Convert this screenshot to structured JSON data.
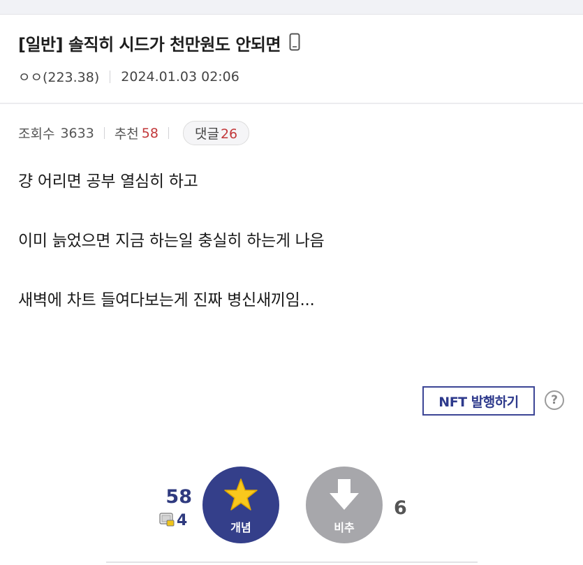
{
  "post": {
    "title": "[일반] 솔직히 시드가 천만원도 안되면",
    "author": "ㅇㅇ(223.38)",
    "date": "2024.01.03 02:06"
  },
  "stats": {
    "views_label": "조회수",
    "views": "3633",
    "recommend_label": "추천",
    "recommend": "58",
    "comments_label": "댓글",
    "comments": "26"
  },
  "body_lines": [
    "걍 어리면 공부 열심히 하고",
    "이미 늙었으면 지금 하는일 충실히 하는게 나음",
    "새벽에 차트 들여다보는게 진짜 병신새끼임..."
  ],
  "actions": {
    "nft_label": "NFT 발행하기",
    "help_symbol": "?",
    "up_count": "58",
    "fixed_count": "4",
    "up_label": "개념",
    "down_label": "비추",
    "down_count": "6"
  },
  "colors": {
    "accent": "#343f8a",
    "recommend_red": "#c2383a",
    "down_gray": "#a7a7ab",
    "star_yellow": "#f9c81d"
  }
}
